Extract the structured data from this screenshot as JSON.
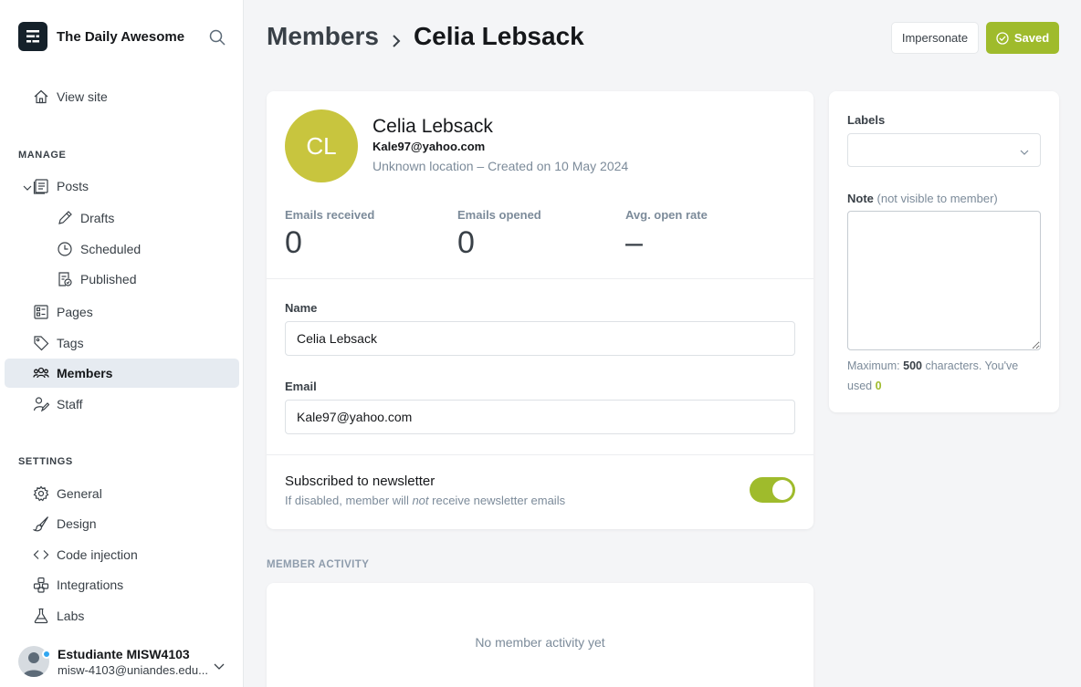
{
  "brand": {
    "name": "The Daily Awesome"
  },
  "sidebar": {
    "view_site": "View site",
    "manage_heading": "MANAGE",
    "posts": "Posts",
    "drafts": "Drafts",
    "scheduled": "Scheduled",
    "published": "Published",
    "pages": "Pages",
    "tags": "Tags",
    "members": "Members",
    "staff": "Staff",
    "settings_heading": "SETTINGS",
    "general": "General",
    "design": "Design",
    "code_injection": "Code injection",
    "integrations": "Integrations",
    "labs": "Labs"
  },
  "user": {
    "name": "Estudiante MISW4103",
    "email": "misw-4103@uniandes.edu..."
  },
  "header": {
    "section": "Members",
    "current": "Celia Lebsack",
    "impersonate_label": "Impersonate",
    "saved_label": "Saved"
  },
  "member": {
    "initials": "CL",
    "name": "Celia Lebsack",
    "email": "Kale97@yahoo.com",
    "meta": "Unknown location – Created on 10 May 2024",
    "avatar_color": "#c8c53e"
  },
  "stats": {
    "emails_received_label": "Emails received",
    "emails_received": "0",
    "emails_opened_label": "Emails opened",
    "emails_opened": "0",
    "open_rate_label": "Avg. open rate",
    "open_rate": "–"
  },
  "form": {
    "name_label": "Name",
    "name_value": "Celia Lebsack",
    "email_label": "Email",
    "email_value": "Kale97@yahoo.com"
  },
  "newsletter": {
    "title": "Subscribed to newsletter",
    "sub_before": "If disabled, member will ",
    "sub_em": "not",
    "sub_after": " receive newsletter emails",
    "enabled": true
  },
  "side": {
    "labels_label": "Labels",
    "note_label": "Note",
    "note_hint_inline": "(not visible to member)",
    "max_prefix": "Maximum: ",
    "max_value": "500",
    "max_suffix": " characters. You've used ",
    "used_value": "0"
  },
  "activity": {
    "heading": "MEMBER ACTIVITY",
    "empty": "No member activity yet"
  },
  "colors": {
    "accent": "#9fbb2c",
    "sidebar_active": "#e6ebf1"
  }
}
